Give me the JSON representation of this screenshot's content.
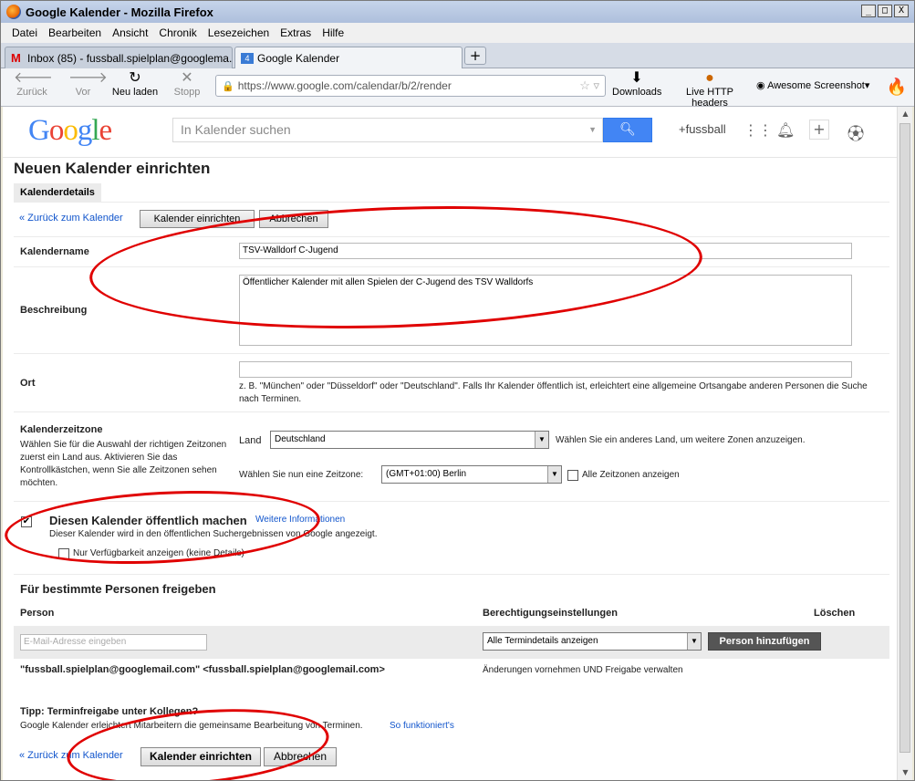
{
  "window": {
    "title": "Google Kalender - Mozilla Firefox",
    "btn_min": "_",
    "btn_max": "□",
    "btn_close": "X"
  },
  "menu": [
    "Datei",
    "Bearbeiten",
    "Ansicht",
    "Chronik",
    "Lesezeichen",
    "Extras",
    "Hilfe"
  ],
  "tabs": [
    {
      "label": "Inbox (85) - fussball.spielplan@googlema...",
      "icon": "gmail-icon"
    },
    {
      "label": "Google Kalender",
      "icon": "calendar-icon"
    }
  ],
  "newtab_label": "+",
  "nav": {
    "back": "Zurück",
    "forward": "Vor",
    "reload": "Neu laden",
    "stop": "Stopp",
    "url": "https://www.google.com/calendar/b/2/render",
    "downloads": "Downloads",
    "livehttp": "Live HTTP headers",
    "screenshot": "Awesome Screenshot"
  },
  "google": {
    "logo": "Google",
    "search_placeholder": "In Kalender suchen",
    "user": "+fussball"
  },
  "page": {
    "title": "Neuen Kalender einrichten",
    "tab": "Kalenderdetails"
  },
  "actions": {
    "back_link": "« Zurück zum Kalender",
    "create": "Kalender einrichten",
    "cancel": "Abbrechen"
  },
  "form": {
    "name_label": "Kalendername",
    "name_value": "TSV-Walldorf C-Jugend",
    "desc_label": "Beschreibung",
    "desc_value": "Öffentlicher Kalender mit allen Spielen der C-Jugend des TSV Walldorfs",
    "loc_label": "Ort",
    "loc_hint": "z. B. \"München\" oder \"Düsseldorf\" oder \"Deutschland\". Falls Ihr Kalender öffentlich ist, erleichtert eine allgemeine Ortsangabe anderen Personen die Suche nach Terminen.",
    "tz_label": "Kalenderzeitzone",
    "tz_help": "Wählen Sie für die Auswahl der richtigen Zeitzonen zuerst ein Land aus. Aktivieren Sie das Kontrollkästchen, wenn Sie alle Zeitzonen sehen möchten.",
    "country_label": "Land",
    "country_value": "Deutschland",
    "country_hint": "Wählen Sie ein anderes Land, um weitere Zonen anzuzeigen.",
    "zone_label": "Wählen Sie nun eine Zeitzone:",
    "zone_value": "(GMT+01:00) Berlin",
    "all_zones": "Alle Zeitzonen anzeigen",
    "public_label": "Diesen Kalender öffentlich machen",
    "public_link": "Weitere Informationen",
    "public_desc": "Dieser Kalender wird in den öffentlichen Suchergebnissen von Google angezeigt.",
    "public_checked": "✔",
    "avail_label": "Nur Verfügbarkeit anzeigen (keine Details)"
  },
  "share": {
    "title": "Für bestimmte Personen freigeben",
    "col_person": "Person",
    "col_perm": "Berechtigungseinstellungen",
    "col_delete": "Löschen",
    "email_placeholder": "E-Mail-Adresse eingeben",
    "perm_value": "Alle Termindetails anzeigen",
    "add_button": "Person hinzufügen",
    "owner": "\"fussball.spielplan@googlemail.com\" <fussball.spielplan@googlemail.com>",
    "owner_perm": "Änderungen vornehmen UND Freigabe verwalten"
  },
  "tip": {
    "title": "Tipp: Terminfreigabe unter Kollegen?",
    "text": "Google Kalender erleichtert Mitarbeitern die gemeinsame Bearbeitung von Terminen.",
    "link": "So funktioniert's"
  }
}
